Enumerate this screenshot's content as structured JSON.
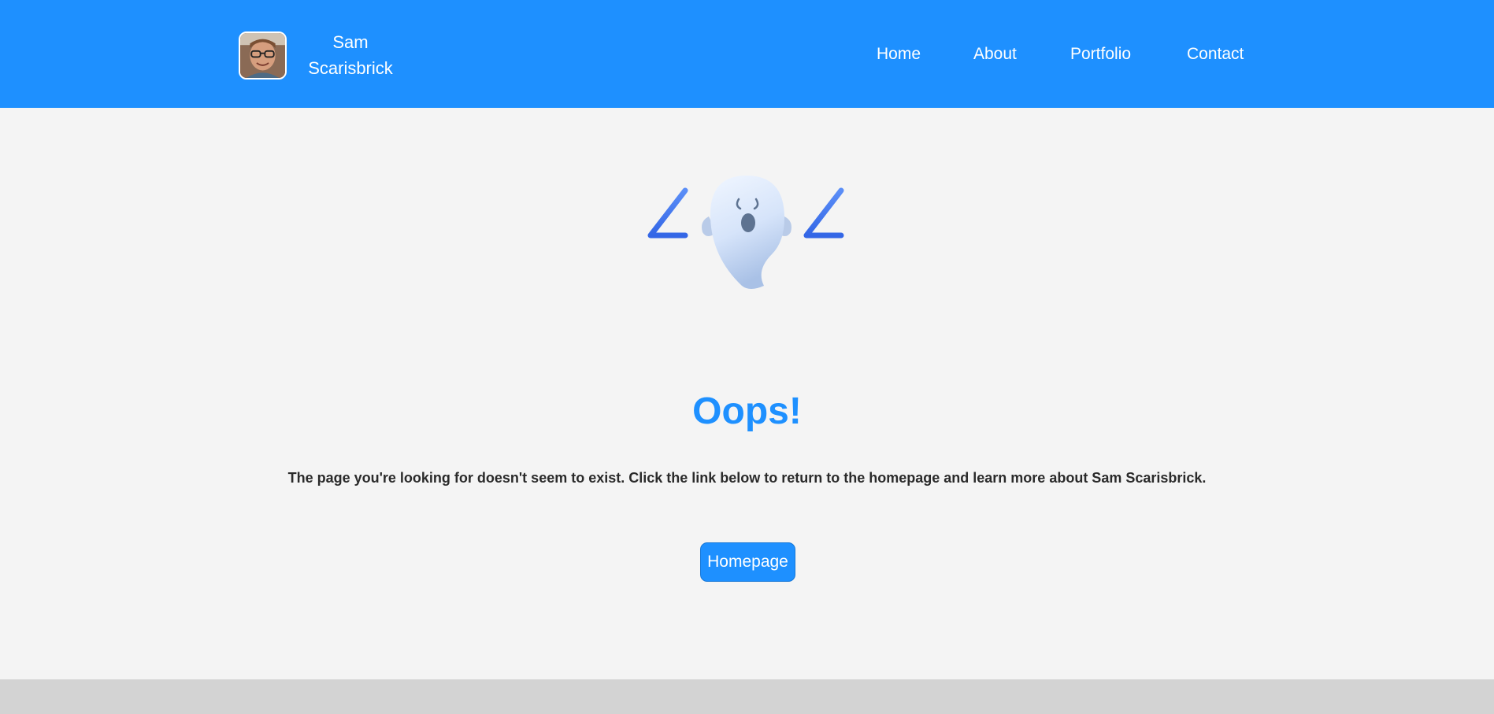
{
  "header": {
    "brand": {
      "name": "Sam Scarisbrick",
      "avatar_icon": "profile-photo"
    },
    "nav": {
      "items": [
        {
          "label": "Home"
        },
        {
          "label": "About"
        },
        {
          "label": "Portfolio"
        },
        {
          "label": "Contact"
        }
      ]
    }
  },
  "main": {
    "illustration_icon": "ghost-404-icon",
    "headline": "Oops!",
    "message": "The page you're looking for doesn't seem to exist. Click the link below to return to the homepage and learn more about Sam Scarisbrick.",
    "button_label": "Homepage"
  },
  "colors": {
    "accent": "#1e90ff",
    "background": "#f4f4f4",
    "footer": "#d3d3d3",
    "text": "#2a2a2a"
  }
}
